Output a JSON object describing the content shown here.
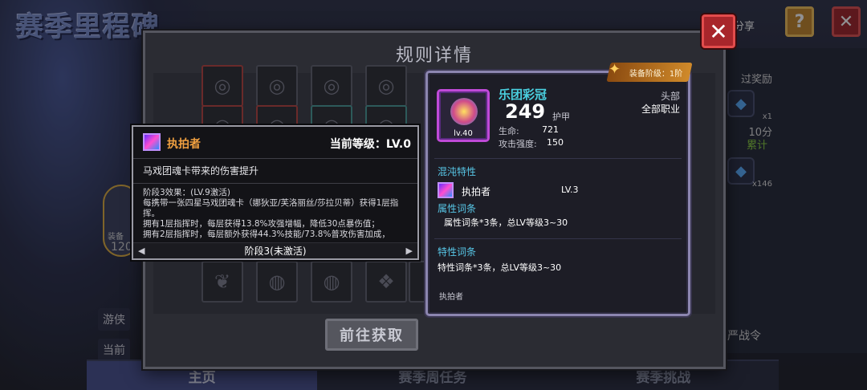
{
  "background": {
    "title": "赛季里程碑",
    "share_label": "分享",
    "help_label": "?",
    "close_label": "✕",
    "side_labels": [
      "过奖励",
      "10分",
      "累计",
      "严战令"
    ],
    "gem_counts": [
      "x1",
      "x146"
    ],
    "left_items": [
      "游侠",
      "当前"
    ],
    "badge_number": "120",
    "badge_label": "装备",
    "tabs": [
      {
        "label": "主页",
        "active": true
      },
      {
        "label": "赛季周任务",
        "active": false
      },
      {
        "label": "赛季挑战",
        "active": false
      }
    ]
  },
  "dialog": {
    "title": "规则详情",
    "close_label": "✕",
    "goto_button": "前往获取"
  },
  "tooltip": {
    "icon": "skill-icon",
    "name": "执拍者",
    "level_label": "当前等级：LV.0",
    "description": "马戏团魂卡带来的伤害提升",
    "stage_effect_title": "阶段3效果：(LV.9激活)",
    "effect_lines": [
      "每携带一张四星马戏团魂卡（娜狄亚/芙洛丽丝/莎拉贝蒂）获得1层指挥。",
      "拥有1层指挥时，每层获得13.8%攻强增幅，降低30点暴伤值；",
      "拥有2层指挥时，每层额外获得44.3%技能/73.8%普攻伤害加成，"
    ],
    "footer": "阶段3(未激活)",
    "prev_arrow": "◀",
    "next_arrow": "▶"
  },
  "card": {
    "stage_badge": "装备阶级：1阶",
    "item_name": "乐团彩冠",
    "item_level": "lv.40",
    "armor_value": "249",
    "armor_label": "护甲",
    "slot_type": "头部",
    "class_type": "全部职业",
    "stats": [
      {
        "label": "生命:",
        "value": "721"
      },
      {
        "label": "攻击强度:",
        "value": "150"
      }
    ],
    "chaos_title": "混沌特性",
    "chaos_trait": {
      "name": "执拍者",
      "level": "LV.3"
    },
    "attr_title": "属性词条",
    "attr_text": "属性词条*3条，总LV等级3~30",
    "trait_title": "特性词条",
    "trait_text": "特性词条*3条，总LV等级3~30",
    "footer_text": "执拍者"
  },
  "colors": {
    "tooltip_name": "#f0a040",
    "item_name": "#4ad0e0",
    "section_title": "#58c8e8",
    "close_red": "#a8262b"
  }
}
